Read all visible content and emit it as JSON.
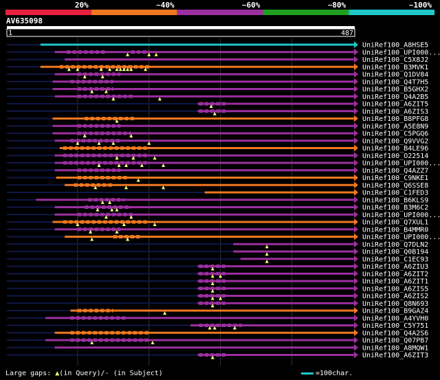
{
  "chart_data": {
    "type": "bar",
    "query": {
      "name": "AV635098",
      "start": 1,
      "end": 487,
      "start_label": "1",
      "end_label": "487"
    },
    "identity_legend": [
      {
        "label": "20%",
        "color": "#e8203c",
        "from": 0,
        "to": 20
      },
      {
        "label": "~40%",
        "color": "#f07820",
        "from": 20,
        "to": 40
      },
      {
        "label": "~60%",
        "color": "#9c2fa0",
        "from": 40,
        "to": 60
      },
      {
        "label": "~80%",
        "color": "#20a020",
        "from": 60,
        "to": 80
      },
      {
        "label": "~100%",
        "color": "#1ec8c8",
        "from": 80,
        "to": 100
      }
    ],
    "hits": [
      {
        "name": "UniRef100_A8HSE5",
        "color": "#1ec8c8",
        "left_tail": 48,
        "start": 48,
        "end": 487,
        "seg": [],
        "gaps": []
      },
      {
        "name": "UniRef100_UPI000...",
        "color": "#9c2fa0",
        "left_tail": 0,
        "start": 68,
        "end": 487,
        "seg": [
          [
            85,
            140
          ],
          [
            175,
            200
          ]
        ],
        "gaps": [
          170,
          200,
          210
        ]
      },
      {
        "name": "UniRef100_C5X8J2",
        "color": "#9c2fa0",
        "left_tail": 48,
        "start": 82,
        "end": 487,
        "seg": [],
        "gaps": []
      },
      {
        "name": "UniRef100_B3MVK1",
        "color": "#f07820",
        "left_tail": 0,
        "start": 48,
        "end": 487,
        "seg": [
          [
            75,
            200
          ]
        ],
        "gaps": [
          88,
          100,
          133,
          145,
          155,
          160,
          165,
          170,
          175,
          195
        ]
      },
      {
        "name": "UniRef100_Q1DV84",
        "color": "#9c2fa0",
        "left_tail": 0,
        "start": 68,
        "end": 487,
        "seg": [
          [
            100,
            160
          ]
        ],
        "gaps": [
          110,
          135
        ]
      },
      {
        "name": "UniRef100_Q4T7H5",
        "color": "#9c2fa0",
        "left_tail": 0,
        "start": 65,
        "end": 487,
        "seg": [
          [
            90,
            150
          ]
        ],
        "gaps": []
      },
      {
        "name": "UniRef100_B5GHX2",
        "color": "#9c2fa0",
        "left_tail": 0,
        "start": 65,
        "end": 487,
        "seg": [
          [
            100,
            150
          ]
        ],
        "gaps": [
          120,
          140
        ]
      },
      {
        "name": "UniRef100_Q4A2B5",
        "color": "#9c2fa0",
        "left_tail": 0,
        "start": 68,
        "end": 487,
        "seg": [
          [
            100,
            180
          ]
        ],
        "gaps": [
          150,
          215
        ]
      },
      {
        "name": "UniRef100_A6ZIT5",
        "color": "#9c2fa0",
        "left_tail": 0,
        "start": 268,
        "end": 487,
        "seg": [
          [
            270,
            310
          ]
        ],
        "gaps": [
          287
        ]
      },
      {
        "name": "UniRef100_A6ZIS3",
        "color": "#9c2fa0",
        "left_tail": 0,
        "start": 268,
        "end": 487,
        "seg": [
          [
            270,
            310
          ]
        ],
        "gaps": [
          292
        ]
      },
      {
        "name": "UniRef100_B8PFG8",
        "color": "#f07820",
        "left_tail": 0,
        "start": 65,
        "end": 487,
        "seg": [
          [
            110,
            180
          ]
        ],
        "gaps": [
          155
        ]
      },
      {
        "name": "UniRef100_A5E8N9",
        "color": "#9c2fa0",
        "left_tail": 0,
        "start": 65,
        "end": 487,
        "seg": [
          [
            100,
            160
          ]
        ],
        "gaps": []
      },
      {
        "name": "UniRef100_C5PGQ6",
        "color": "#9c2fa0",
        "left_tail": 0,
        "start": 65,
        "end": 487,
        "seg": [
          [
            100,
            175
          ]
        ],
        "gaps": [
          110,
          175
        ]
      },
      {
        "name": "UniRef100_Q9VVG2",
        "color": "#9c2fa0",
        "left_tail": 0,
        "start": 68,
        "end": 487,
        "seg": [
          [
            90,
            160
          ]
        ],
        "gaps": [
          100,
          130,
          150,
          200
        ]
      },
      {
        "name": "UniRef100_B4LE96",
        "color": "#f07820",
        "left_tail": 0,
        "start": 75,
        "end": 487,
        "seg": [
          [
            80,
            200
          ]
        ],
        "gaps": []
      },
      {
        "name": "UniRef100_O22514",
        "color": "#9c2fa0",
        "left_tail": 0,
        "start": 68,
        "end": 487,
        "seg": [
          [
            80,
            200
          ]
        ],
        "gaps": [
          155,
          178,
          208
        ]
      },
      {
        "name": "UniRef100_UPI000...",
        "color": "#9c2fa0",
        "left_tail": 0,
        "start": 68,
        "end": 487,
        "seg": [
          [
            80,
            200
          ]
        ],
        "gaps": [
          130,
          158,
          168,
          190,
          220
        ]
      },
      {
        "name": "UniRef100_Q4AZZ7",
        "color": "#9c2fa0",
        "left_tail": 0,
        "start": 68,
        "end": 487,
        "seg": [
          [
            100,
            160
          ]
        ],
        "gaps": []
      },
      {
        "name": "UniRef100_C9NKE1",
        "color": "#f07820",
        "left_tail": 0,
        "start": 70,
        "end": 487,
        "seg": [
          [
            100,
            170
          ]
        ],
        "gaps": [
          185
        ]
      },
      {
        "name": "UniRef100_Q6SSE8",
        "color": "#f07820",
        "left_tail": 0,
        "start": 82,
        "end": 487,
        "seg": [
          [
            95,
            150
          ]
        ],
        "gaps": [
          125,
          168,
          220
        ]
      },
      {
        "name": "UniRef100_C1FED3",
        "color": "#f07820",
        "left_tail": 0,
        "start": 278,
        "end": 487,
        "seg": [],
        "gaps": []
      },
      {
        "name": "UniRef100_B6KLS9",
        "color": "#9c2fa0",
        "left_tail": 0,
        "start": 42,
        "end": 487,
        "seg": [
          [
            115,
            165
          ]
        ],
        "gaps": [
          135,
          145
        ]
      },
      {
        "name": "UniRef100_B3M6C2",
        "color": "#9c2fa0",
        "left_tail": 0,
        "start": 68,
        "end": 487,
        "seg": [
          [
            110,
            175
          ]
        ],
        "gaps": [
          128,
          148,
          155
        ]
      },
      {
        "name": "UniRef100_UPI000...",
        "color": "#9c2fa0",
        "left_tail": 0,
        "start": 68,
        "end": 487,
        "seg": [
          [
            100,
            180
          ]
        ],
        "gaps": [
          140,
          175
        ]
      },
      {
        "name": "UniRef100_Q7XUL1",
        "color": "#f07820",
        "left_tail": 0,
        "start": 65,
        "end": 487,
        "seg": [
          [
            80,
            200
          ]
        ],
        "gaps": [
          100,
          165,
          208
        ]
      },
      {
        "name": "UniRef100_B4MMR0",
        "color": "#9c2fa0",
        "left_tail": 0,
        "start": 68,
        "end": 487,
        "seg": [
          [
            100,
            160
          ]
        ],
        "gaps": [
          118,
          155
        ]
      },
      {
        "name": "UniRef100_UPI000...",
        "color": "#f07820",
        "left_tail": 0,
        "start": 82,
        "end": 487,
        "seg": [
          [
            150,
            190
          ]
        ],
        "gaps": [
          120,
          170
        ]
      },
      {
        "name": "UniRef100_Q7DLN2",
        "color": "#9c2fa0",
        "left_tail": 0,
        "start": 318,
        "end": 487,
        "seg": [],
        "gaps": [
          365
        ]
      },
      {
        "name": "UniRef100_Q0B194",
        "color": "#9c2fa0",
        "left_tail": 0,
        "start": 318,
        "end": 487,
        "seg": [],
        "gaps": [
          365
        ]
      },
      {
        "name": "UniRef100_C1EC93",
        "color": "#9c2fa0",
        "left_tail": 0,
        "start": 328,
        "end": 487,
        "seg": [],
        "gaps": [
          365
        ]
      },
      {
        "name": "UniRef100_A6ZIU3",
        "color": "#9c2fa0",
        "left_tail": 0,
        "start": 268,
        "end": 487,
        "seg": [
          [
            270,
            310
          ]
        ],
        "gaps": [
          289
        ]
      },
      {
        "name": "UniRef100_A6ZIT2",
        "color": "#9c2fa0",
        "left_tail": 0,
        "start": 268,
        "end": 487,
        "seg": [
          [
            270,
            310
          ]
        ],
        "gaps": [
          289,
          300
        ]
      },
      {
        "name": "UniRef100_A6ZIT1",
        "color": "#9c2fa0",
        "left_tail": 0,
        "start": 268,
        "end": 487,
        "seg": [
          [
            270,
            310
          ]
        ],
        "gaps": [
          289
        ]
      },
      {
        "name": "UniRef100_A6ZIS5",
        "color": "#9c2fa0",
        "left_tail": 0,
        "start": 268,
        "end": 487,
        "seg": [
          [
            270,
            310
          ]
        ],
        "gaps": [
          289
        ]
      },
      {
        "name": "UniRef100_A6ZIS2",
        "color": "#9c2fa0",
        "left_tail": 0,
        "start": 268,
        "end": 487,
        "seg": [
          [
            270,
            310
          ]
        ],
        "gaps": [
          289,
          300
        ]
      },
      {
        "name": "UniRef100_Q8N693",
        "color": "#9c2fa0",
        "left_tail": 0,
        "start": 268,
        "end": 487,
        "seg": [
          [
            270,
            310
          ]
        ],
        "gaps": [
          289
        ]
      },
      {
        "name": "UniRef100_B9GAZ4",
        "color": "#f07820",
        "left_tail": 0,
        "start": 90,
        "end": 487,
        "seg": [
          [
            100,
            150
          ]
        ],
        "gaps": [
          222
        ]
      },
      {
        "name": "UniRef100_A4YVH0",
        "color": "#9c2fa0",
        "left_tail": 0,
        "start": 55,
        "end": 487,
        "seg": [
          [
            90,
            170
          ]
        ],
        "gaps": []
      },
      {
        "name": "UniRef100_C5Y751",
        "color": "#9c2fa0",
        "left_tail": 0,
        "start": 258,
        "end": 487,
        "seg": [
          [
            270,
            330
          ]
        ],
        "gaps": [
          285,
          292,
          320
        ]
      },
      {
        "name": "UniRef100_Q4A2S6",
        "color": "#f07820",
        "left_tail": 0,
        "start": 68,
        "end": 487,
        "seg": [
          [
            90,
            200
          ]
        ],
        "gaps": []
      },
      {
        "name": "UniRef100_Q07PB7",
        "color": "#9c2fa0",
        "left_tail": 0,
        "start": 55,
        "end": 487,
        "seg": [
          [
            90,
            200
          ]
        ],
        "gaps": [
          120,
          205
        ]
      },
      {
        "name": "UniRef100_A8MQW1",
        "color": "#9c2fa0",
        "left_tail": 0,
        "start": 68,
        "end": 487,
        "seg": [],
        "gaps": []
      },
      {
        "name": "UniRef100_A6ZIT3",
        "color": "#9c2fa0",
        "left_tail": 0,
        "start": 268,
        "end": 487,
        "seg": [
          [
            270,
            310
          ]
        ],
        "gaps": [
          289
        ]
      }
    ]
  },
  "footer": {
    "large_gaps_label": "Large gaps:",
    "in_query": "(in Query)/-",
    "in_subject": "(in Subject)",
    "scale_label": "=100char.",
    "scale_color": "#1ec8c8"
  }
}
